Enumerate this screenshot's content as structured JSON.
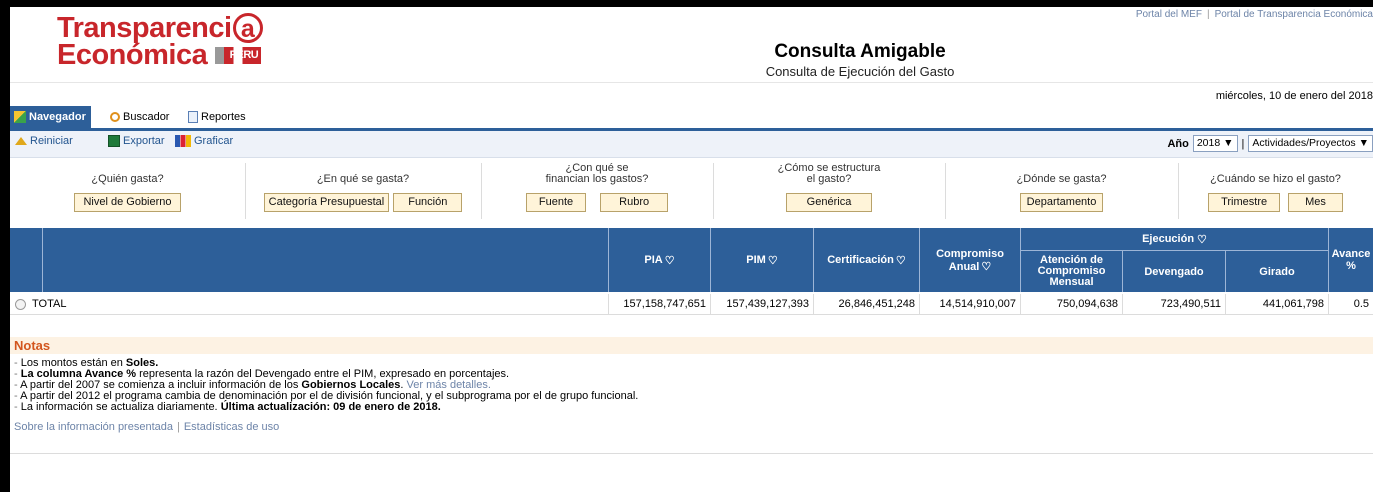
{
  "header": {
    "logo_line1": "Transparenci",
    "logo_ring": "a",
    "logo_line2": "Económica",
    "logo_flag": "PERU",
    "title": "Consulta Amigable",
    "subtitle": "Consulta de Ejecución del Gasto",
    "links": [
      "Portal del MEF",
      "Portal de Transparencia Económica"
    ],
    "date": "miércoles, 10 de enero del 2018"
  },
  "tabs": [
    {
      "label": "Navegador",
      "icon": "cube-icon"
    },
    {
      "label": "Buscador",
      "icon": "magnifier-icon"
    },
    {
      "label": "Reportes",
      "icon": "document-icon"
    }
  ],
  "toolbar": {
    "reiniciar": "Reiniciar",
    "exportar": "Exportar",
    "graficar": "Graficar",
    "year_label": "Año",
    "year_value": "2018",
    "view_value": "Actividades/Proyectos"
  },
  "queries": [
    {
      "label": "¿Quién gasta?",
      "buttons": [
        "Nivel de Gobierno"
      ]
    },
    {
      "label": "¿En qué se gasta?",
      "buttons": [
        "Categoría Presupuestal",
        "Función"
      ]
    },
    {
      "label1": "¿Con qué se",
      "label2": "financian los gastos?",
      "buttons": [
        "Fuente",
        "Rubro"
      ]
    },
    {
      "label1": "¿Cómo se estructura",
      "label2": "el gasto?",
      "buttons": [
        "Genérica"
      ]
    },
    {
      "label": "¿Dónde se gasta?",
      "buttons": [
        "Departamento"
      ]
    },
    {
      "label": "¿Cuándo se hizo el gasto?",
      "buttons": [
        "Trimestre",
        "Mes"
      ]
    }
  ],
  "table": {
    "headers": {
      "pia": "PIA",
      "pim": "PIM",
      "certificacion": "Certificación",
      "compromiso_1": "Compromiso",
      "compromiso_2": "Anual",
      "ejecucion": "Ejecución",
      "atencion_1": "Atención de",
      "atencion_2": "Compromiso",
      "atencion_3": "Mensual",
      "devengado": "Devengado",
      "girado": "Girado",
      "avance_1": "Avance",
      "avance_2": "%"
    },
    "row": {
      "label": "TOTAL",
      "pia": "157,158,747,651",
      "pim": "157,439,127,393",
      "certificacion": "26,846,451,248",
      "compromiso": "14,514,910,007",
      "atencion": "750,094,638",
      "devengado": "723,490,511",
      "girado": "441,061,798",
      "avance": "0.5"
    }
  },
  "notes": {
    "title": "Notas",
    "n1_a": "Los montos están en ",
    "n1_b": "Soles.",
    "n2_a": "La columna Avance %",
    "n2_b": " representa la razón del Devengado entre el PIM, expresado en porcentajes.",
    "n3_a": "A partir del 2007 se comienza a incluir información de los ",
    "n3_b": "Gobiernos Locales",
    "n3_c": ". ",
    "n3_link": "Ver más detalles.",
    "n4": "A partir del 2012 el programa cambia de denominación por el de división funcional, y el subprograma por el de grupo funcional.",
    "n5_a": "La información se actualiza diariamente. ",
    "n5_b": "Última actualización: 09 de enero de 2018.",
    "link1": "Sobre la información presentada",
    "link2": "Estadísticas de uso"
  },
  "colors": {
    "brand_red": "#c8262b",
    "header_blue": "#2d5f99",
    "notes_orange": "#d3561e"
  }
}
